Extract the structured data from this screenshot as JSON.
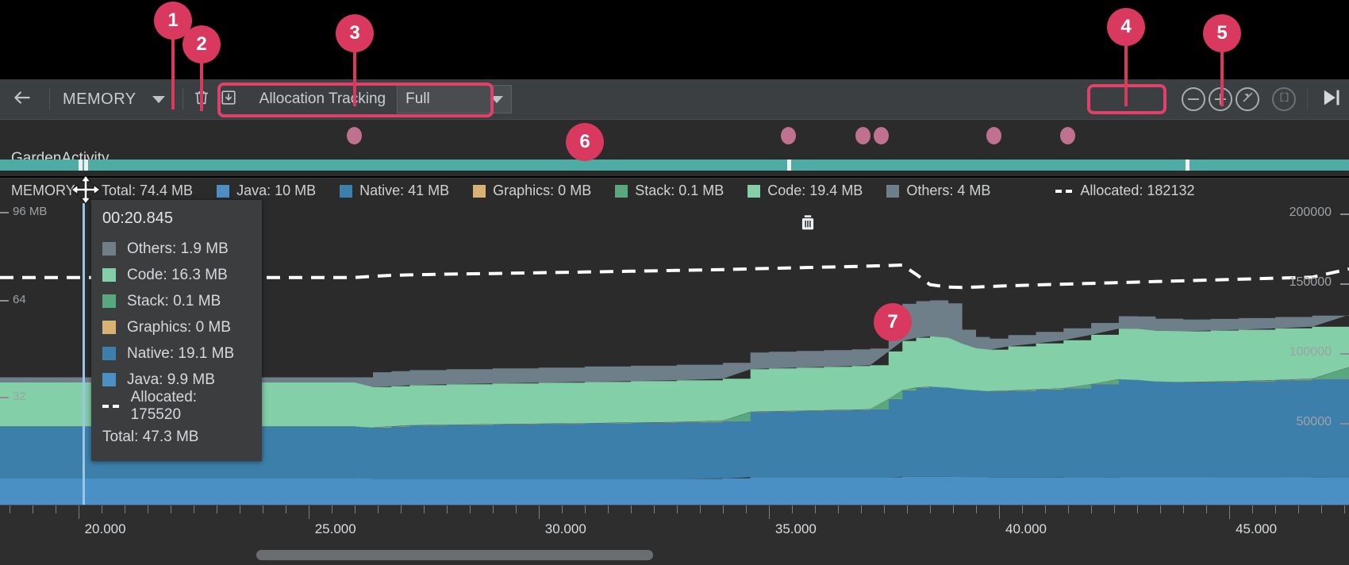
{
  "toolbar": {
    "back_icon": "arrow-left-icon",
    "title": "MEMORY",
    "dropdown_caret": "chevron-down-icon",
    "trash_icon": "trash-icon",
    "export_icon": "export-heap-dump-icon",
    "allocation_label": "Allocation Tracking",
    "allocation_value": "Full",
    "zoom_out_icon": "zoom-out-icon",
    "zoom_in_icon": "zoom-in-icon",
    "reset_zoom_icon": "reset-zoom-icon",
    "fit_icon": "zoom-to-selection-icon",
    "jump_to_live_icon": "jump-to-live-icon"
  },
  "activity": {
    "name": "GardenActivity",
    "band_color": "#4dada4",
    "event_marker_color": "#c0718f"
  },
  "legend": {
    "title": "MEMORY",
    "total": "Total: 74.4 MB",
    "items": [
      {
        "label": "Java: 10 MB",
        "color": "#4a90c4"
      },
      {
        "label": "Native: 41 MB",
        "color": "#3c7fab"
      },
      {
        "label": "Graphics: 0 MB",
        "color": "#d7b274"
      },
      {
        "label": "Stack: 0.1 MB",
        "color": "#57a87f"
      },
      {
        "label": "Code: 19.4 MB",
        "color": "#82cfa8"
      },
      {
        "label": "Others: 4 MB",
        "color": "#6f7f8a"
      }
    ],
    "allocated": "Allocated: 182132"
  },
  "tooltip": {
    "time": "00:20.845",
    "rows": [
      {
        "label": "Others: 1.9 MB",
        "color": "#6f7f8a"
      },
      {
        "label": "Code: 16.3 MB",
        "color": "#82cfa8"
      },
      {
        "label": "Stack: 0.1 MB",
        "color": "#57a87f"
      },
      {
        "label": "Graphics: 0 MB",
        "color": "#d7b274"
      },
      {
        "label": "Native: 19.1 MB",
        "color": "#3c7fab"
      },
      {
        "label": "Java: 9.9 MB",
        "color": "#4a90c4"
      }
    ],
    "allocated": "Allocated: 175520",
    "total": "Total: 47.3 MB"
  },
  "axes": {
    "left_ticks": [
      "96 MB",
      "64",
      "32"
    ],
    "right_ticks": [
      "200000",
      "150000",
      "100000",
      "50000"
    ],
    "x_ticks": [
      "20.000",
      "25.000",
      "30.000",
      "35.000",
      "40.000",
      "45.000"
    ]
  },
  "callouts": [
    {
      "number": "1"
    },
    {
      "number": "2"
    },
    {
      "number": "3"
    },
    {
      "number": "4"
    },
    {
      "number": "5"
    },
    {
      "number": "6"
    },
    {
      "number": "7"
    }
  ],
  "chart_data": {
    "type": "area",
    "title": "MEMORY",
    "xlabel": "",
    "ylabel": "MB",
    "xlim": [
      18.3,
      47.6
    ],
    "ylim": [
      0,
      112
    ],
    "right_ylim": [
      0,
      233000
    ],
    "grid": false,
    "legend": "top",
    "stack_order": [
      "Java",
      "Native",
      "Graphics",
      "Stack",
      "Code",
      "Others"
    ],
    "colors": {
      "Java": "#4a90c4",
      "Native": "#3c7fab",
      "Graphics": "#d7b274",
      "Stack": "#57a87f",
      "Code": "#82cfa8",
      "Others": "#6f7f8a",
      "Allocated": "#ffffff"
    },
    "x": [
      18.3,
      19.0,
      20.0,
      20.845,
      21.5,
      22.5,
      23.5,
      24.5,
      25.0,
      25.6,
      26.0,
      26.4,
      26.8,
      27.2,
      28.0,
      29.0,
      30.0,
      31.0,
      32.0,
      33.0,
      34.0,
      34.6,
      35.0,
      35.6,
      36.2,
      36.8,
      37.2,
      37.6,
      37.9,
      38.2,
      38.5,
      38.9,
      39.2,
      39.5,
      39.8,
      40.2,
      40.8,
      41.4,
      42.0,
      42.6,
      43.0,
      43.4,
      44.0,
      44.6,
      45.2,
      46.0,
      46.8,
      47.6
    ],
    "series": [
      {
        "name": "Java",
        "values": [
          9.9,
          9.9,
          9.9,
          9.9,
          9.9,
          9.9,
          9.9,
          9.9,
          9.9,
          9.9,
          9.9,
          9.6,
          9.6,
          9.6,
          9.6,
          9.6,
          9.6,
          9.6,
          9.6,
          9.6,
          9.8,
          10.2,
          10.2,
          10.2,
          10.2,
          10.2,
          10.2,
          10.2,
          10.4,
          10.4,
          10.4,
          10.4,
          10.3,
          10.2,
          10.1,
          10.1,
          10.1,
          10.2,
          10.2,
          10.3,
          10.3,
          10.3,
          10.3,
          10.2,
          10.2,
          10.2,
          10.1,
          10.0
        ]
      },
      {
        "name": "Native",
        "values": [
          19.1,
          19.1,
          19.1,
          19.1,
          19.1,
          19.1,
          19.1,
          19.1,
          19.1,
          19.1,
          19.1,
          19.0,
          19.4,
          19.8,
          20.0,
          20.2,
          20.4,
          20.6,
          20.8,
          21.0,
          21.3,
          24.2,
          24.4,
          24.6,
          24.8,
          25.0,
          25.2,
          29.0,
          32.0,
          33.0,
          33.4,
          33.0,
          32.5,
          32.2,
          32.0,
          32.2,
          32.6,
          33.0,
          34.5,
          36.2,
          36.0,
          35.4,
          35.2,
          35.4,
          35.6,
          36.0,
          36.6,
          41.0
        ]
      },
      {
        "name": "Graphics",
        "values": [
          0,
          0,
          0,
          0,
          0,
          0,
          0,
          0,
          0,
          0,
          0,
          0,
          0,
          0,
          0,
          0,
          0,
          0,
          0,
          0,
          0,
          0,
          0,
          0,
          0,
          0,
          0,
          0,
          0,
          0,
          0,
          0,
          0,
          0,
          0,
          0,
          0,
          0,
          0,
          0,
          0,
          0,
          0,
          0,
          0,
          0,
          0,
          0
        ]
      },
      {
        "name": "Stack",
        "values": [
          0.1,
          0.1,
          0.1,
          0.1,
          0.1,
          0.1,
          0.1,
          0.1,
          0.1,
          0.1,
          0.1,
          0.1,
          0.1,
          0.1,
          0.1,
          0.1,
          0.1,
          0.1,
          0.1,
          0.1,
          0.1,
          0.1,
          0.1,
          0.1,
          0.1,
          0.1,
          0.1,
          0.1,
          0.1,
          0.1,
          0.1,
          0.1,
          0.1,
          0.1,
          0.1,
          0.1,
          0.1,
          0.1,
          0.1,
          0.1,
          0.1,
          0.1,
          0.1,
          0.1,
          0.1,
          0.1,
          0.1,
          0.1
        ]
      },
      {
        "name": "Code",
        "values": [
          16.3,
          16.3,
          16.3,
          16.3,
          16.3,
          16.3,
          16.3,
          16.3,
          16.3,
          16.3,
          16.3,
          15.0,
          14.9,
          14.9,
          15.0,
          15.1,
          15.2,
          15.3,
          15.4,
          15.5,
          15.6,
          15.8,
          15.9,
          16.0,
          16.1,
          16.2,
          16.3,
          17.6,
          18.3,
          18.5,
          18.6,
          18.5,
          16.9,
          15.6,
          15.4,
          16.4,
          17.1,
          17.8,
          18.3,
          18.8,
          18.9,
          18.8,
          18.8,
          19.0,
          19.1,
          19.2,
          19.3,
          19.4
        ]
      },
      {
        "name": "Others",
        "values": [
          1.9,
          1.9,
          1.9,
          1.9,
          1.9,
          1.9,
          1.9,
          1.9,
          1.9,
          1.9,
          1.9,
          5.5,
          5.6,
          5.6,
          5.6,
          5.6,
          5.6,
          5.7,
          5.7,
          5.8,
          5.9,
          6.2,
          6.2,
          6.2,
          6.2,
          6.2,
          6.2,
          9.8,
          13.8,
          13.6,
          13.4,
          12.8,
          5.2,
          4.2,
          4.1,
          4.2,
          4.3,
          4.4,
          4.4,
          4.6,
          4.6,
          4.5,
          4.4,
          4.3,
          4.3,
          4.2,
          4.1,
          4.0
        ]
      }
    ],
    "allocated_line": {
      "name": "Allocated",
      "style": "dashed",
      "values": [
        175520,
        175520,
        175520,
        175520,
        175520,
        175520,
        175520,
        175520,
        175520,
        175520,
        175520,
        176500,
        177200,
        177600,
        178100,
        178600,
        179200,
        179800,
        180400,
        181000,
        181600,
        182200,
        182600,
        183000,
        183600,
        184000,
        184400,
        184800,
        185200,
        178000,
        170000,
        168200,
        167800,
        168200,
        168600,
        169200,
        169800,
        170400,
        171000,
        171600,
        172000,
        172400,
        173000,
        173600,
        174200,
        175000,
        175800,
        182132
      ]
    },
    "markers": [
      {
        "type": "gc",
        "x": 37.6
      }
    ]
  }
}
